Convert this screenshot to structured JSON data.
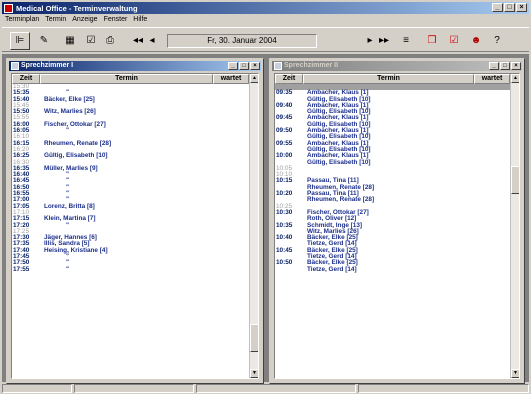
{
  "app": {
    "title": "Medical Office - Terminverwaltung"
  },
  "menu": [
    "Terminplan",
    "Termin",
    "Anzeige",
    "Fenster",
    "Hilfe"
  ],
  "toolbar": {
    "date": "Fr, 30. Januar 2004"
  },
  "grid_headers": {
    "zeit": "Zeit",
    "termin": "Termin",
    "wartet": "wartet"
  },
  "room1": {
    "title": "Sprechzimmer I",
    "rows": [
      {
        "t": "15:30",
        "n": "",
        "q": true
      },
      {
        "t": "15:35",
        "n": "\"",
        "q": false
      },
      {
        "t": "15:40",
        "n": "Bäcker, Elke [25]",
        "q": false
      },
      {
        "t": "15:45",
        "n": "",
        "q": true
      },
      {
        "t": "15:50",
        "n": "Witz, Marlies [26]",
        "q": false
      },
      {
        "t": "15:55",
        "n": "",
        "q": true
      },
      {
        "t": "16:00",
        "n": "Fischer, Ottokar [27]",
        "q": false
      },
      {
        "t": "16:05",
        "n": "\"",
        "q": false
      },
      {
        "t": "16:10",
        "n": "",
        "q": true
      },
      {
        "t": "16:15",
        "n": "Rheumen, Renate [28]",
        "q": false
      },
      {
        "t": "16:20",
        "n": "",
        "q": true
      },
      {
        "t": "16:25",
        "n": "Gültig, Elisabeth [10]",
        "q": false
      },
      {
        "t": "16:30",
        "n": "",
        "q": true
      },
      {
        "t": "16:35",
        "n": "Müller, Marlies [9]",
        "q": false
      },
      {
        "t": "16:40",
        "n": "\"",
        "q": false
      },
      {
        "t": "16:45",
        "n": "\"",
        "q": false
      },
      {
        "t": "16:50",
        "n": "\"",
        "q": false
      },
      {
        "t": "16:55",
        "n": "\"",
        "q": false
      },
      {
        "t": "17:00",
        "n": "\"",
        "q": false
      },
      {
        "t": "17:05",
        "n": "Lorenz, Britta [8]",
        "q": false
      },
      {
        "t": "17:10",
        "n": "",
        "q": true
      },
      {
        "t": "17:15",
        "n": "Klein, Martina [7]",
        "q": false
      },
      {
        "t": "17:20",
        "n": "\"",
        "q": false
      },
      {
        "t": "17:25",
        "n": "",
        "q": true
      },
      {
        "t": "17:30",
        "n": "Jäger, Hannes [6]",
        "q": false
      },
      {
        "t": "17:35",
        "n": "Illis, Sandra [5]",
        "q": false
      },
      {
        "t": "17:40",
        "n": "Heising, Kristiane [4]",
        "q": false
      },
      {
        "t": "17:45",
        "n": "\"",
        "q": false
      },
      {
        "t": "17:50",
        "n": "\"",
        "q": false
      },
      {
        "t": "17:55",
        "n": "\"",
        "q": false
      }
    ]
  },
  "room2": {
    "title": "Sprechzimmer II",
    "rows": [
      {
        "t": "09:30",
        "n": "",
        "q": true,
        "sel": true
      },
      {
        "t": "09:35",
        "n": "Ambacher, Klaus [1]",
        "q": false
      },
      {
        "t": "",
        "n": "Gültig, Elisabeth [10]",
        "q": false
      },
      {
        "t": "09:40",
        "n": "Ambacher, Klaus [1]",
        "q": false
      },
      {
        "t": "",
        "n": "Gültig, Elisabeth [10]",
        "q": false
      },
      {
        "t": "09:45",
        "n": "Ambacher, Klaus [1]",
        "q": false
      },
      {
        "t": "",
        "n": "Gültig, Elisabeth [10]",
        "q": false
      },
      {
        "t": "09:50",
        "n": "Ambacher, Klaus [1]",
        "q": false
      },
      {
        "t": "",
        "n": "Gültig, Elisabeth [10]",
        "q": false
      },
      {
        "t": "09:55",
        "n": "Ambacher, Klaus [1]",
        "q": false
      },
      {
        "t": "",
        "n": "Gültig, Elisabeth [10]",
        "q": false
      },
      {
        "t": "10:00",
        "n": "Ambacher, Klaus [1]",
        "q": false
      },
      {
        "t": "",
        "n": "Gültig, Elisabeth [10]",
        "q": false
      },
      {
        "t": "10:05",
        "n": "",
        "q": true
      },
      {
        "t": "10:10",
        "n": "",
        "q": true
      },
      {
        "t": "10:15",
        "n": "Passau, Tina [11]",
        "q": false
      },
      {
        "t": "",
        "n": "Rheumen, Renate [28]",
        "q": false
      },
      {
        "t": "10:20",
        "n": "Passau, Tina [11]",
        "q": false
      },
      {
        "t": "",
        "n": "Rheumen, Renate [28]",
        "q": false
      },
      {
        "t": "10:25",
        "n": "",
        "q": true
      },
      {
        "t": "10:30",
        "n": "Fischer, Ottokar [27]",
        "q": false
      },
      {
        "t": "",
        "n": "Roth, Oliver [12]",
        "q": false
      },
      {
        "t": "10:35",
        "n": "Schmidt, Inge [13]",
        "q": false
      },
      {
        "t": "",
        "n": "Witz, Marlies [26]",
        "q": false
      },
      {
        "t": "10:40",
        "n": "Bäcker, Elke [25]",
        "q": false
      },
      {
        "t": "",
        "n": "Tietze, Gerd [14]",
        "q": false
      },
      {
        "t": "10:45",
        "n": "Bäcker, Elke [25]",
        "q": false
      },
      {
        "t": "",
        "n": "Tietze, Gerd [14]",
        "q": false
      },
      {
        "t": "10:50",
        "n": "Bäcker, Elke [25]",
        "q": false
      },
      {
        "t": "",
        "n": "Tietze, Gerd [14]",
        "q": false
      }
    ]
  }
}
